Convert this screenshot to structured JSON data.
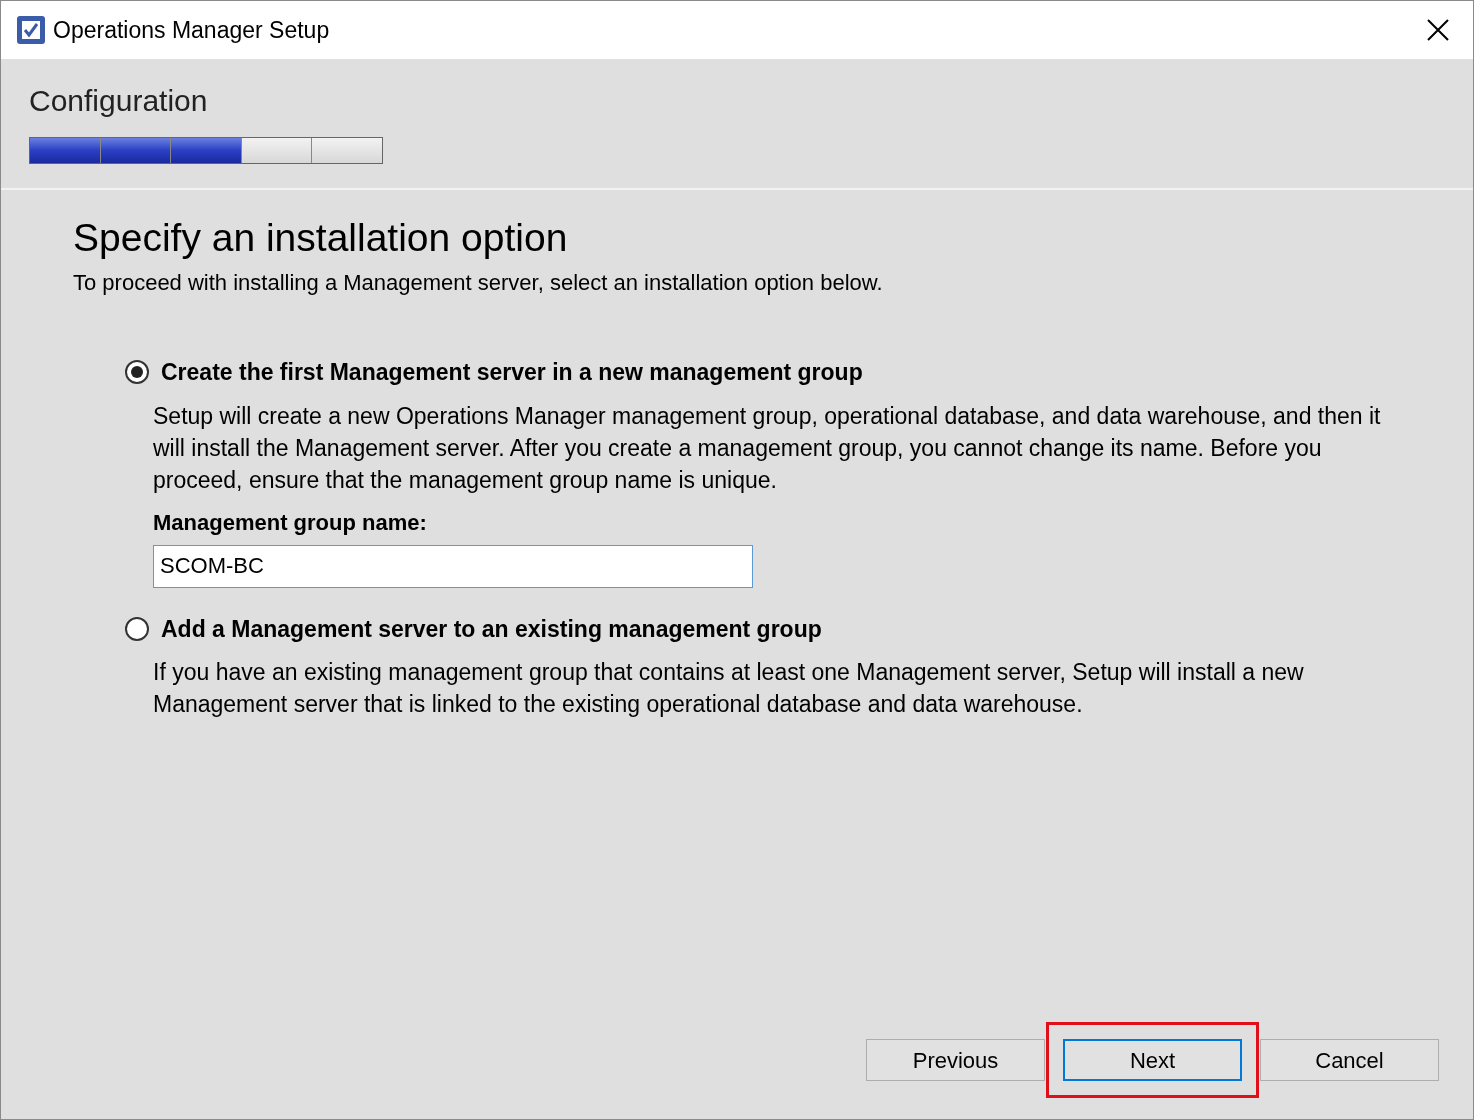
{
  "window": {
    "title": "Operations Manager Setup"
  },
  "header": {
    "title": "Configuration",
    "progress_steps": [
      {
        "filled": true
      },
      {
        "filled": true
      },
      {
        "filled": true
      },
      {
        "filled": false
      },
      {
        "filled": false
      }
    ]
  },
  "page": {
    "heading": "Specify an installation option",
    "subtitle": "To proceed with installing a Management server, select an installation option below."
  },
  "options": [
    {
      "label": "Create the first Management server in a new management group",
      "selected": true,
      "description": "Setup will create a new Operations Manager management group, operational database, and data warehouse, and then it will install the Management server. After you create a management group, you cannot change its name. Before you proceed, ensure that the management group name is unique.",
      "field": {
        "label": "Management group name:",
        "value": "SCOM-BC"
      }
    },
    {
      "label": "Add a Management server to an existing management group",
      "selected": false,
      "description": "If you have an existing management group that contains at least one Management server, Setup will install a new Management server that is linked to the existing operational database and data warehouse."
    }
  ],
  "buttons": [
    {
      "label": "Previous",
      "default": false,
      "highlighted": false
    },
    {
      "label": "Next",
      "default": true,
      "highlighted": true
    },
    {
      "label": "Cancel",
      "default": false,
      "highlighted": false
    }
  ]
}
